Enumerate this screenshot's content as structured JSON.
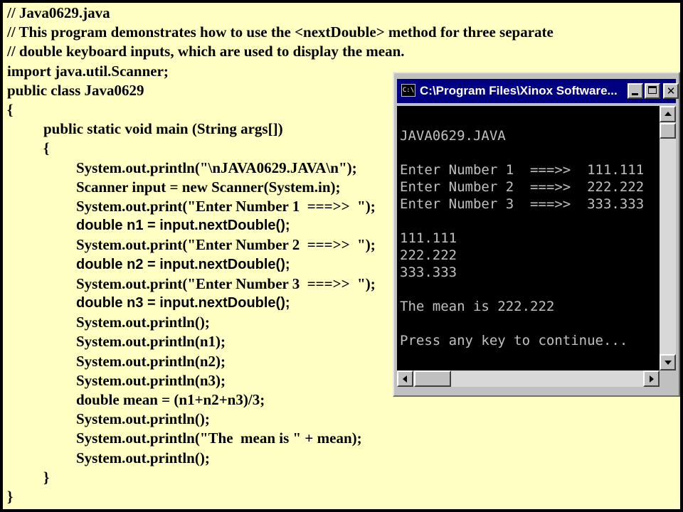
{
  "source_code": {
    "lines": [
      {
        "text": "// Java0629.java",
        "indent": 0,
        "highlight": false
      },
      {
        "text": "// This program demonstrates how to use the <nextDouble> method for three separate",
        "indent": 0,
        "highlight": false
      },
      {
        "text": "// double keyboard inputs, which are used to display the mean.",
        "indent": 0,
        "highlight": false
      },
      {
        "text": "import java.util.Scanner;",
        "indent": 0,
        "highlight": false
      },
      {
        "text": "public class Java0629",
        "indent": 0,
        "highlight": false
      },
      {
        "text": "{",
        "indent": 0,
        "highlight": false
      },
      {
        "text": "public static void main (String args[])",
        "indent": 1,
        "highlight": false
      },
      {
        "text": "{",
        "indent": 1,
        "highlight": false
      },
      {
        "text": "System.out.println(\"\\nJAVA0629.JAVA\\n\");",
        "indent": 2,
        "highlight": false
      },
      {
        "text": "Scanner input = new Scanner(System.in);",
        "indent": 2,
        "highlight": false
      },
      {
        "text": "System.out.print(\"Enter Number 1  ===>>  \");",
        "indent": 2,
        "highlight": false
      },
      {
        "text": "double n1 = input.nextDouble();",
        "indent": 2,
        "highlight": true
      },
      {
        "text": "System.out.print(\"Enter Number 2  ===>>  \");",
        "indent": 2,
        "highlight": false
      },
      {
        "text": "double n2 = input.nextDouble();",
        "indent": 2,
        "highlight": true
      },
      {
        "text": "System.out.print(\"Enter Number 3  ===>>  \");",
        "indent": 2,
        "highlight": false
      },
      {
        "text": "double n3 = input.nextDouble();",
        "indent": 2,
        "highlight": true
      },
      {
        "text": "System.out.println();",
        "indent": 2,
        "highlight": false
      },
      {
        "text": "System.out.println(n1);",
        "indent": 2,
        "highlight": false
      },
      {
        "text": "System.out.println(n2);",
        "indent": 2,
        "highlight": false
      },
      {
        "text": "System.out.println(n3);",
        "indent": 2,
        "highlight": false
      },
      {
        "text": "double mean = (n1+n2+n3)/3;",
        "indent": 2,
        "highlight": false
      },
      {
        "text": "System.out.println();",
        "indent": 2,
        "highlight": false
      },
      {
        "text": "System.out.println(\"The  mean is \" + mean);",
        "indent": 2,
        "highlight": false
      },
      {
        "text": "System.out.println();",
        "indent": 2,
        "highlight": false
      },
      {
        "text": "}",
        "indent": 1,
        "highlight": false
      },
      {
        "text": "}",
        "indent": 0,
        "highlight": false
      }
    ]
  },
  "console_window": {
    "title": "C:\\Program Files\\Xinox Software...",
    "icon": "console-app-icon",
    "icon_text": "C:\\",
    "buttons": {
      "minimize": "minimize-icon",
      "maximize": "maximize-icon",
      "close": "close-icon",
      "close_glyph": "✕"
    },
    "lines": [
      "",
      "JAVA0629.JAVA",
      "",
      "Enter Number 1  ===>>  111.111",
      "Enter Number 2  ===>>  222.222",
      "Enter Number 3  ===>>  333.333",
      "",
      "111.111",
      "222.222",
      "333.333",
      "",
      "The mean is 222.222",
      "",
      "Press any key to continue..."
    ]
  },
  "colors": {
    "slide_background": "#ffffc4",
    "frame": "#000000",
    "title_bar": "#000080",
    "console_text": "#c0c0c0"
  }
}
